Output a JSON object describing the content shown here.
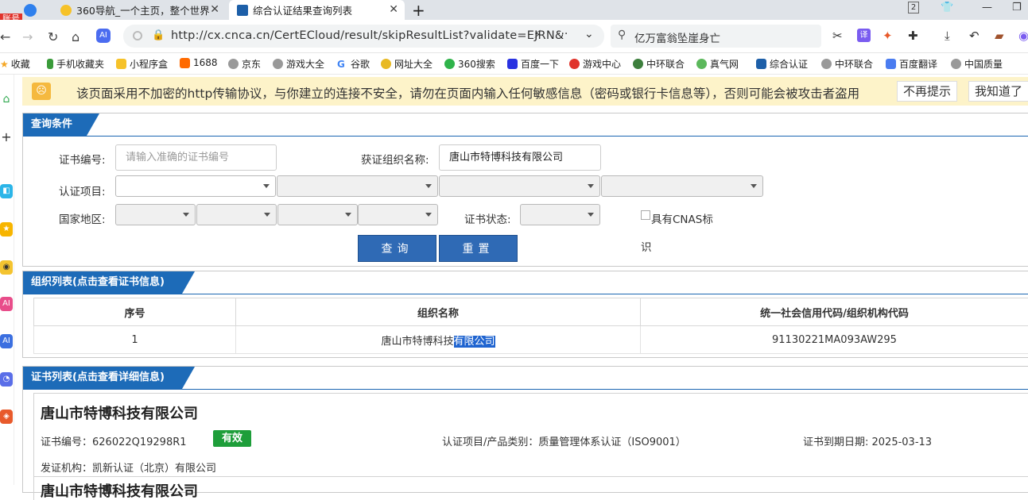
{
  "browser": {
    "account_badge": "账号",
    "tabs": [
      {
        "title": "360导航_一个主页，整个世界",
        "active": false
      },
      {
        "title": "综合认证结果查询列表",
        "active": true
      }
    ],
    "new_tab_symbol": "+",
    "tab_counter": "2",
    "url": "http://cx.cnca.cn/CertECloud/result/skipResultList?validate=EJRN&",
    "search_text": "亿万富翁坠崖身亡",
    "bookmarks": [
      "收藏",
      "手机收藏夹",
      "小程序盒",
      "1688",
      "京东",
      "游戏大全",
      "谷歌",
      "网址大全",
      "360搜索",
      "百度一下",
      "游戏中心",
      "中环联合",
      "真气网",
      "综合认证",
      "中环联合",
      "百度翻译",
      "中国质量"
    ]
  },
  "warning": {
    "text": "该页面采用不加密的http传输协议，与你建立的连接不安全，请勿在页面内输入任何敏感信息（密码或银行卡信息等），否则可能会被攻击者盗用",
    "btn_no_remind": "不再提示",
    "btn_got_it": "我知道了"
  },
  "query": {
    "header": "查询条件",
    "cert_no_label": "证书编号:",
    "cert_no_placeholder": "请输入准确的证书编号",
    "org_name_label": "获证组织名称:",
    "org_name_value": "唐山市特博科技有限公司",
    "project_label": "认证项目:",
    "region_label": "国家地区:",
    "status_label": "证书状态:",
    "cnas_label": "具有CNAS标",
    "cnas_label_2": "识",
    "search_btn": "查询",
    "reset_btn": "重置"
  },
  "org_list": {
    "header": "组织列表(点击查看证书信息)",
    "columns": [
      "序号",
      "组织名称",
      "统一社会信用代码/组织机构代码"
    ],
    "rows": [
      {
        "index": "1",
        "name_plain": "唐山市特博科技",
        "name_selected": "有限公司",
        "code": "91130221MA093AW295"
      }
    ]
  },
  "cert_list": {
    "header": "证书列表(点击查看详细信息)",
    "company": "唐山市特博科技有限公司",
    "cert_no": "证书编号：626022Q19298R1",
    "status": "有效",
    "category": "认证项目/产品类别：质量管理体系认证（ISO9001）",
    "expiry": "证书到期日期: 2025-03-13",
    "issuer": "发证机构：凯新认证（北京）有限公司",
    "next_company_partial": "唐山市特博科技有限公司"
  }
}
